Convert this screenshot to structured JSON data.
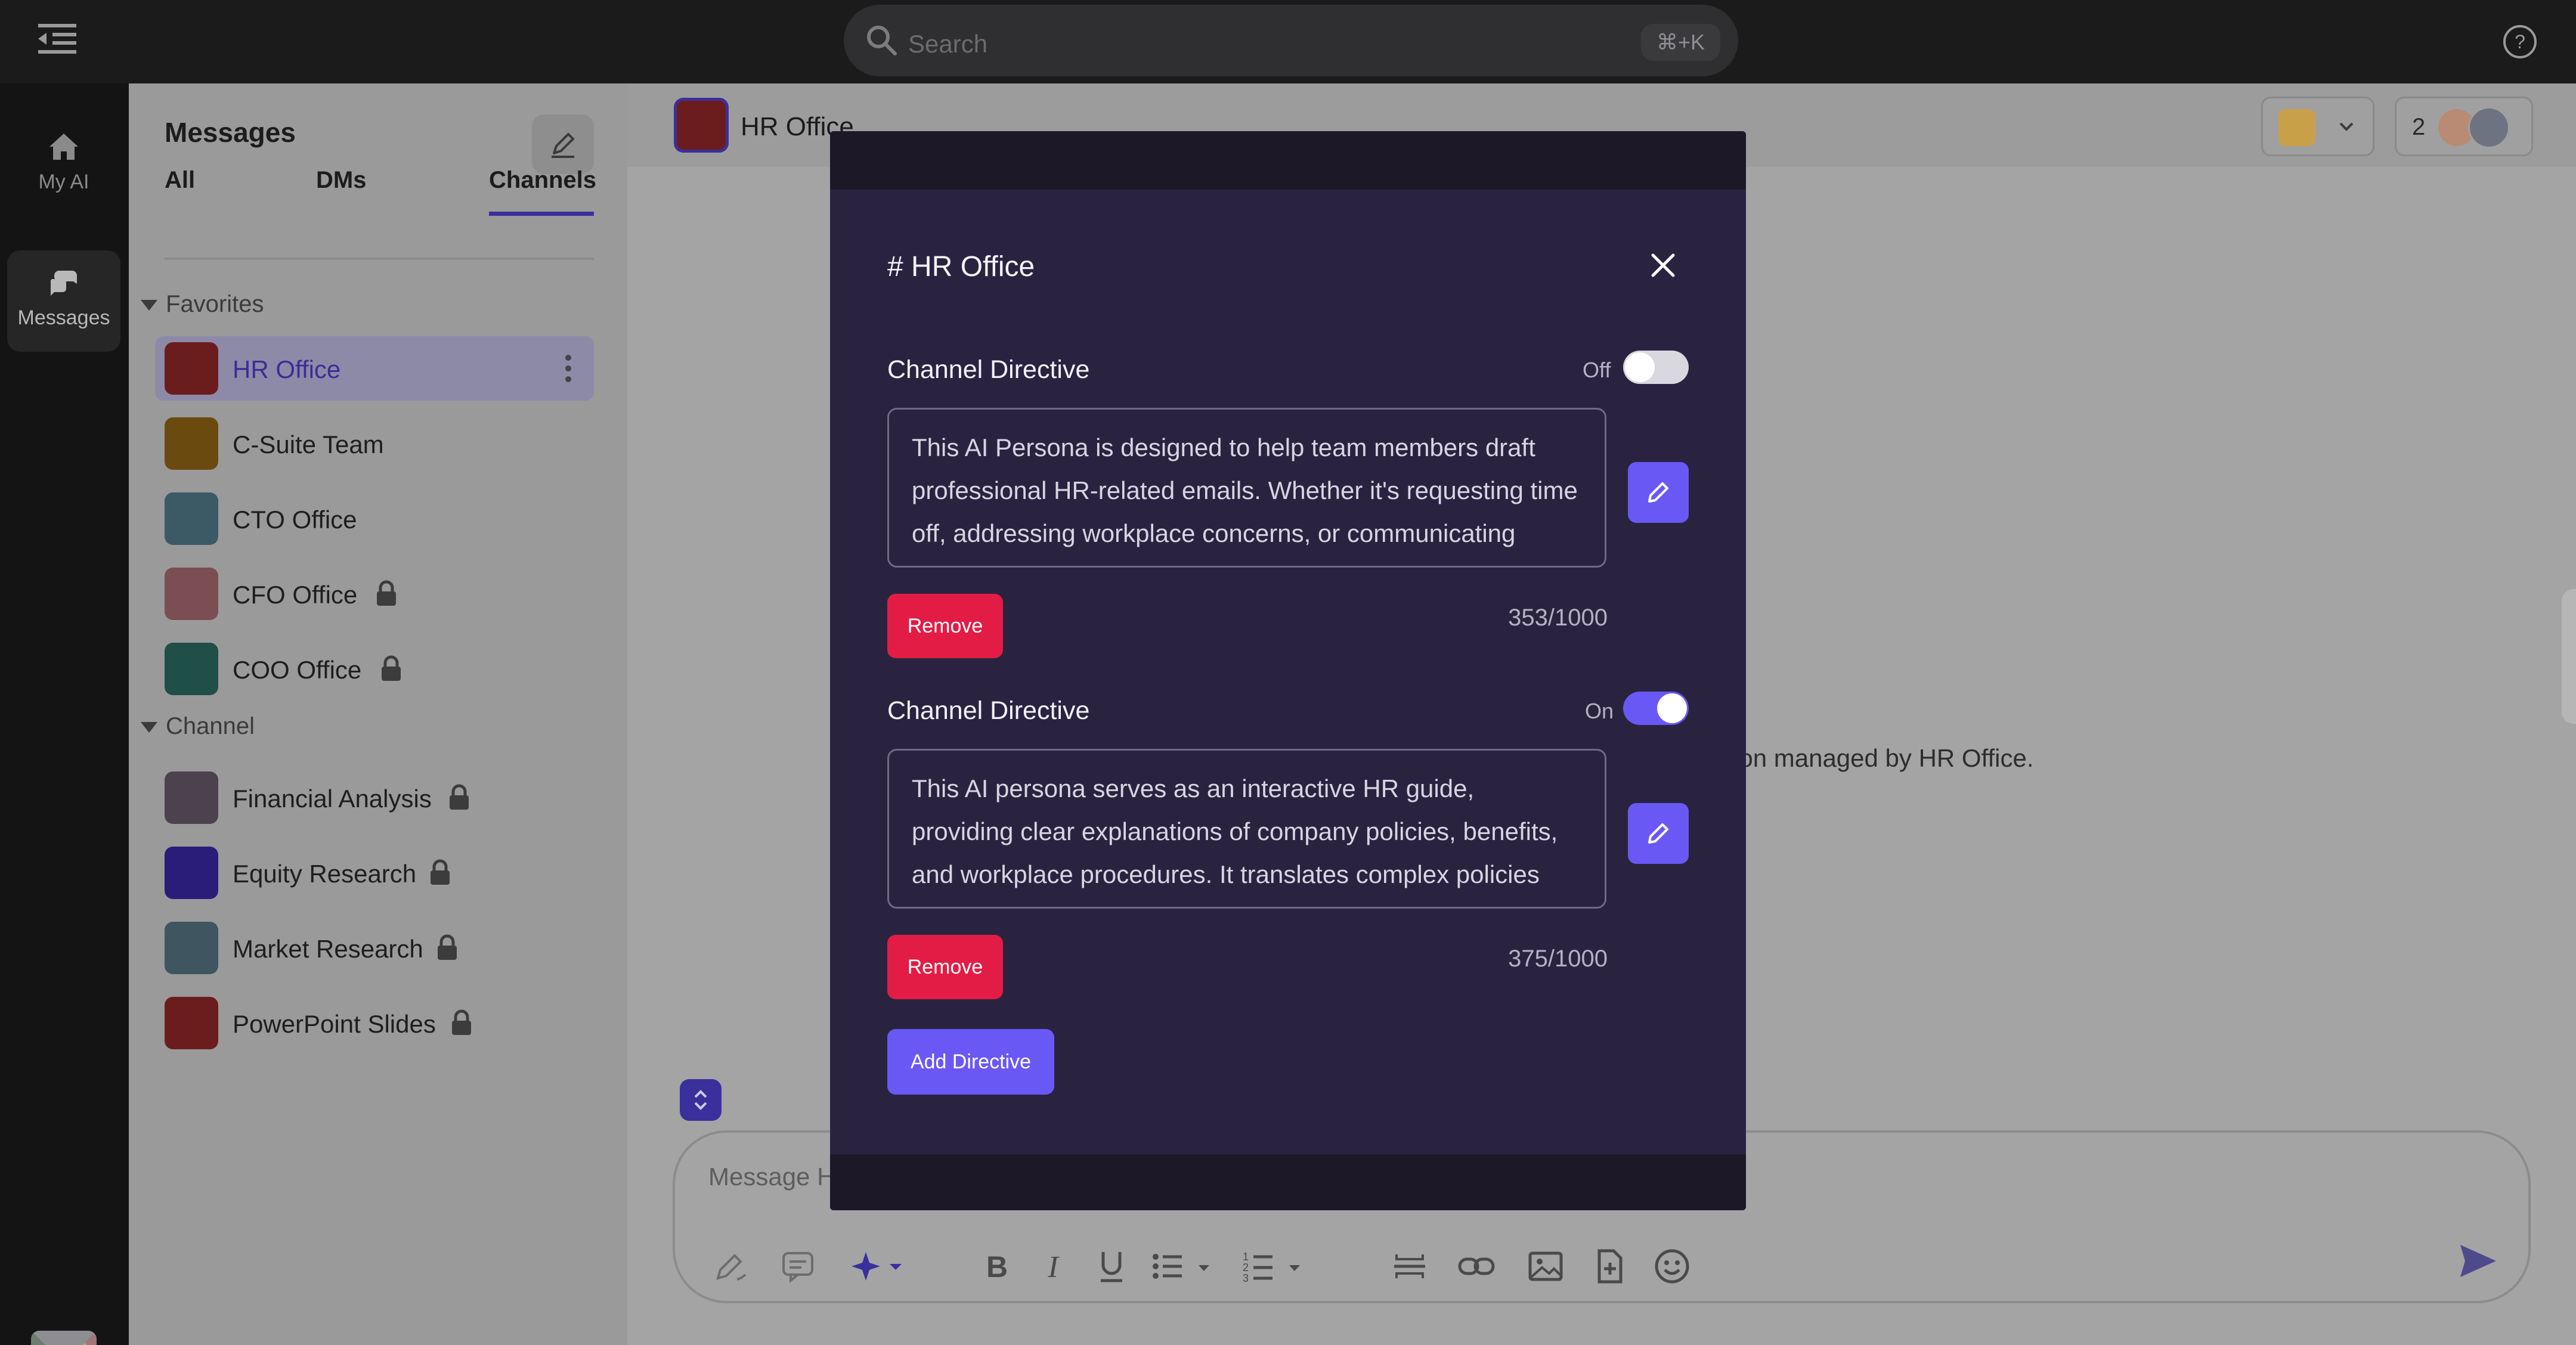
{
  "topbar": {
    "search_placeholder": "Search",
    "search_shortcut": "⌘+K",
    "icons": [
      "menu-toggle-icon",
      "search-icon",
      "help-icon"
    ]
  },
  "rail": {
    "items": [
      {
        "label": "My AI",
        "icon": "home-icon"
      },
      {
        "label": "Messages",
        "icon": "messages-icon"
      }
    ]
  },
  "messages": {
    "title": "Messages",
    "tabs": [
      "All",
      "DMs",
      "Channels"
    ],
    "active_tab": "Channels",
    "favorites_label": "Favorites",
    "favorites": [
      {
        "name": "HR Office",
        "color": "#6b1d1d",
        "locked": false,
        "selected": true
      },
      {
        "name": "C-Suite Team",
        "color": "#6b4a10",
        "locked": false
      },
      {
        "name": "CTO Office",
        "color": "#3b5a66",
        "locked": false
      },
      {
        "name": "CFO Office",
        "color": "#7b4e53",
        "locked": true
      },
      {
        "name": "COO Office",
        "color": "#1f4f47",
        "locked": true
      }
    ],
    "channel_label": "Channel",
    "channels": [
      {
        "name": "Financial Analysis",
        "color": "#4b424d",
        "locked": true
      },
      {
        "name": "Equity Research",
        "color": "#2a1d7a",
        "locked": true
      },
      {
        "name": "Market Research",
        "color": "#3f5560",
        "locked": true
      },
      {
        "name": "PowerPoint Slides",
        "color": "#6b1d1d",
        "locked": true
      }
    ]
  },
  "chat": {
    "channel_name": "HR Office",
    "member_count": "2",
    "info_fragment": "ation managed by HR Office.",
    "composer_placeholder": "Message H"
  },
  "modal": {
    "title": "# HR Office",
    "directives": [
      {
        "label": "Channel Directive",
        "toggle_text": "Off",
        "enabled": false,
        "text": "This AI Persona is designed to help team members draft professional HR-related emails. Whether it's requesting time off, addressing workplace concerns, or communicating policy",
        "remove_label": "Remove",
        "counter": "353/1000"
      },
      {
        "label": "Channel Directive",
        "toggle_text": "On",
        "enabled": true,
        "text": "This AI persona serves as an interactive HR guide, providing clear explanations of company policies, benefits, and workplace procedures. It translates complex policies into",
        "remove_label": "Remove",
        "counter": "375/1000"
      }
    ],
    "add_label": "Add Directive"
  },
  "colors": {
    "accent": "#6a58f5",
    "danger": "#e31c45",
    "modal_bg": "#2a2340"
  }
}
